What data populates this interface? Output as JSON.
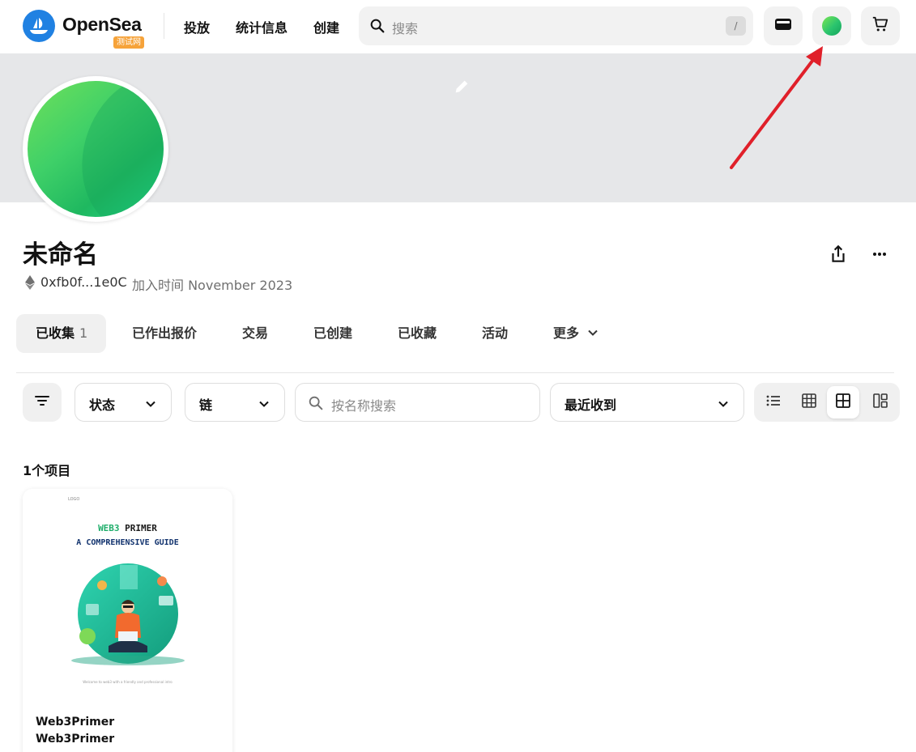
{
  "header": {
    "brand": "OpenSea",
    "testnet_badge": "测试网",
    "nav": [
      "投放",
      "统计信息",
      "创建"
    ],
    "search_placeholder": "搜索",
    "search_shortcut": "/",
    "wallet_icon": "wallet-icon",
    "cart_icon": "cart-icon"
  },
  "profile": {
    "name": "未命名",
    "address": "0xfb0f...1e0C",
    "joined": "加入时间 November 2023"
  },
  "tabs": [
    {
      "label": "已收集",
      "count": "1"
    },
    {
      "label": "已作出报价"
    },
    {
      "label": "交易"
    },
    {
      "label": "已创建"
    },
    {
      "label": "已收藏"
    },
    {
      "label": "活动"
    },
    {
      "label": "更多"
    }
  ],
  "filters": {
    "status": "状态",
    "chain": "链",
    "name_search_placeholder": "按名称搜索",
    "sort": "最近收到"
  },
  "results": {
    "count_label": "1个项目",
    "items": [
      {
        "title": "Web3Primer",
        "collection": "Web3Primer",
        "cover": {
          "brand": "LOGO",
          "title_a": "WEB3",
          "title_b": " PRIMER",
          "subtitle": "A COMPREHENSIVE GUIDE",
          "footer": "Welcome to web3 with a friendly and professional intro"
        }
      }
    ]
  },
  "colors": {
    "brand_blue": "#2081e2",
    "testnet_orange": "#f6a33a",
    "avatar_green": "#2bc46e",
    "annotation_red": "#e0202a"
  }
}
